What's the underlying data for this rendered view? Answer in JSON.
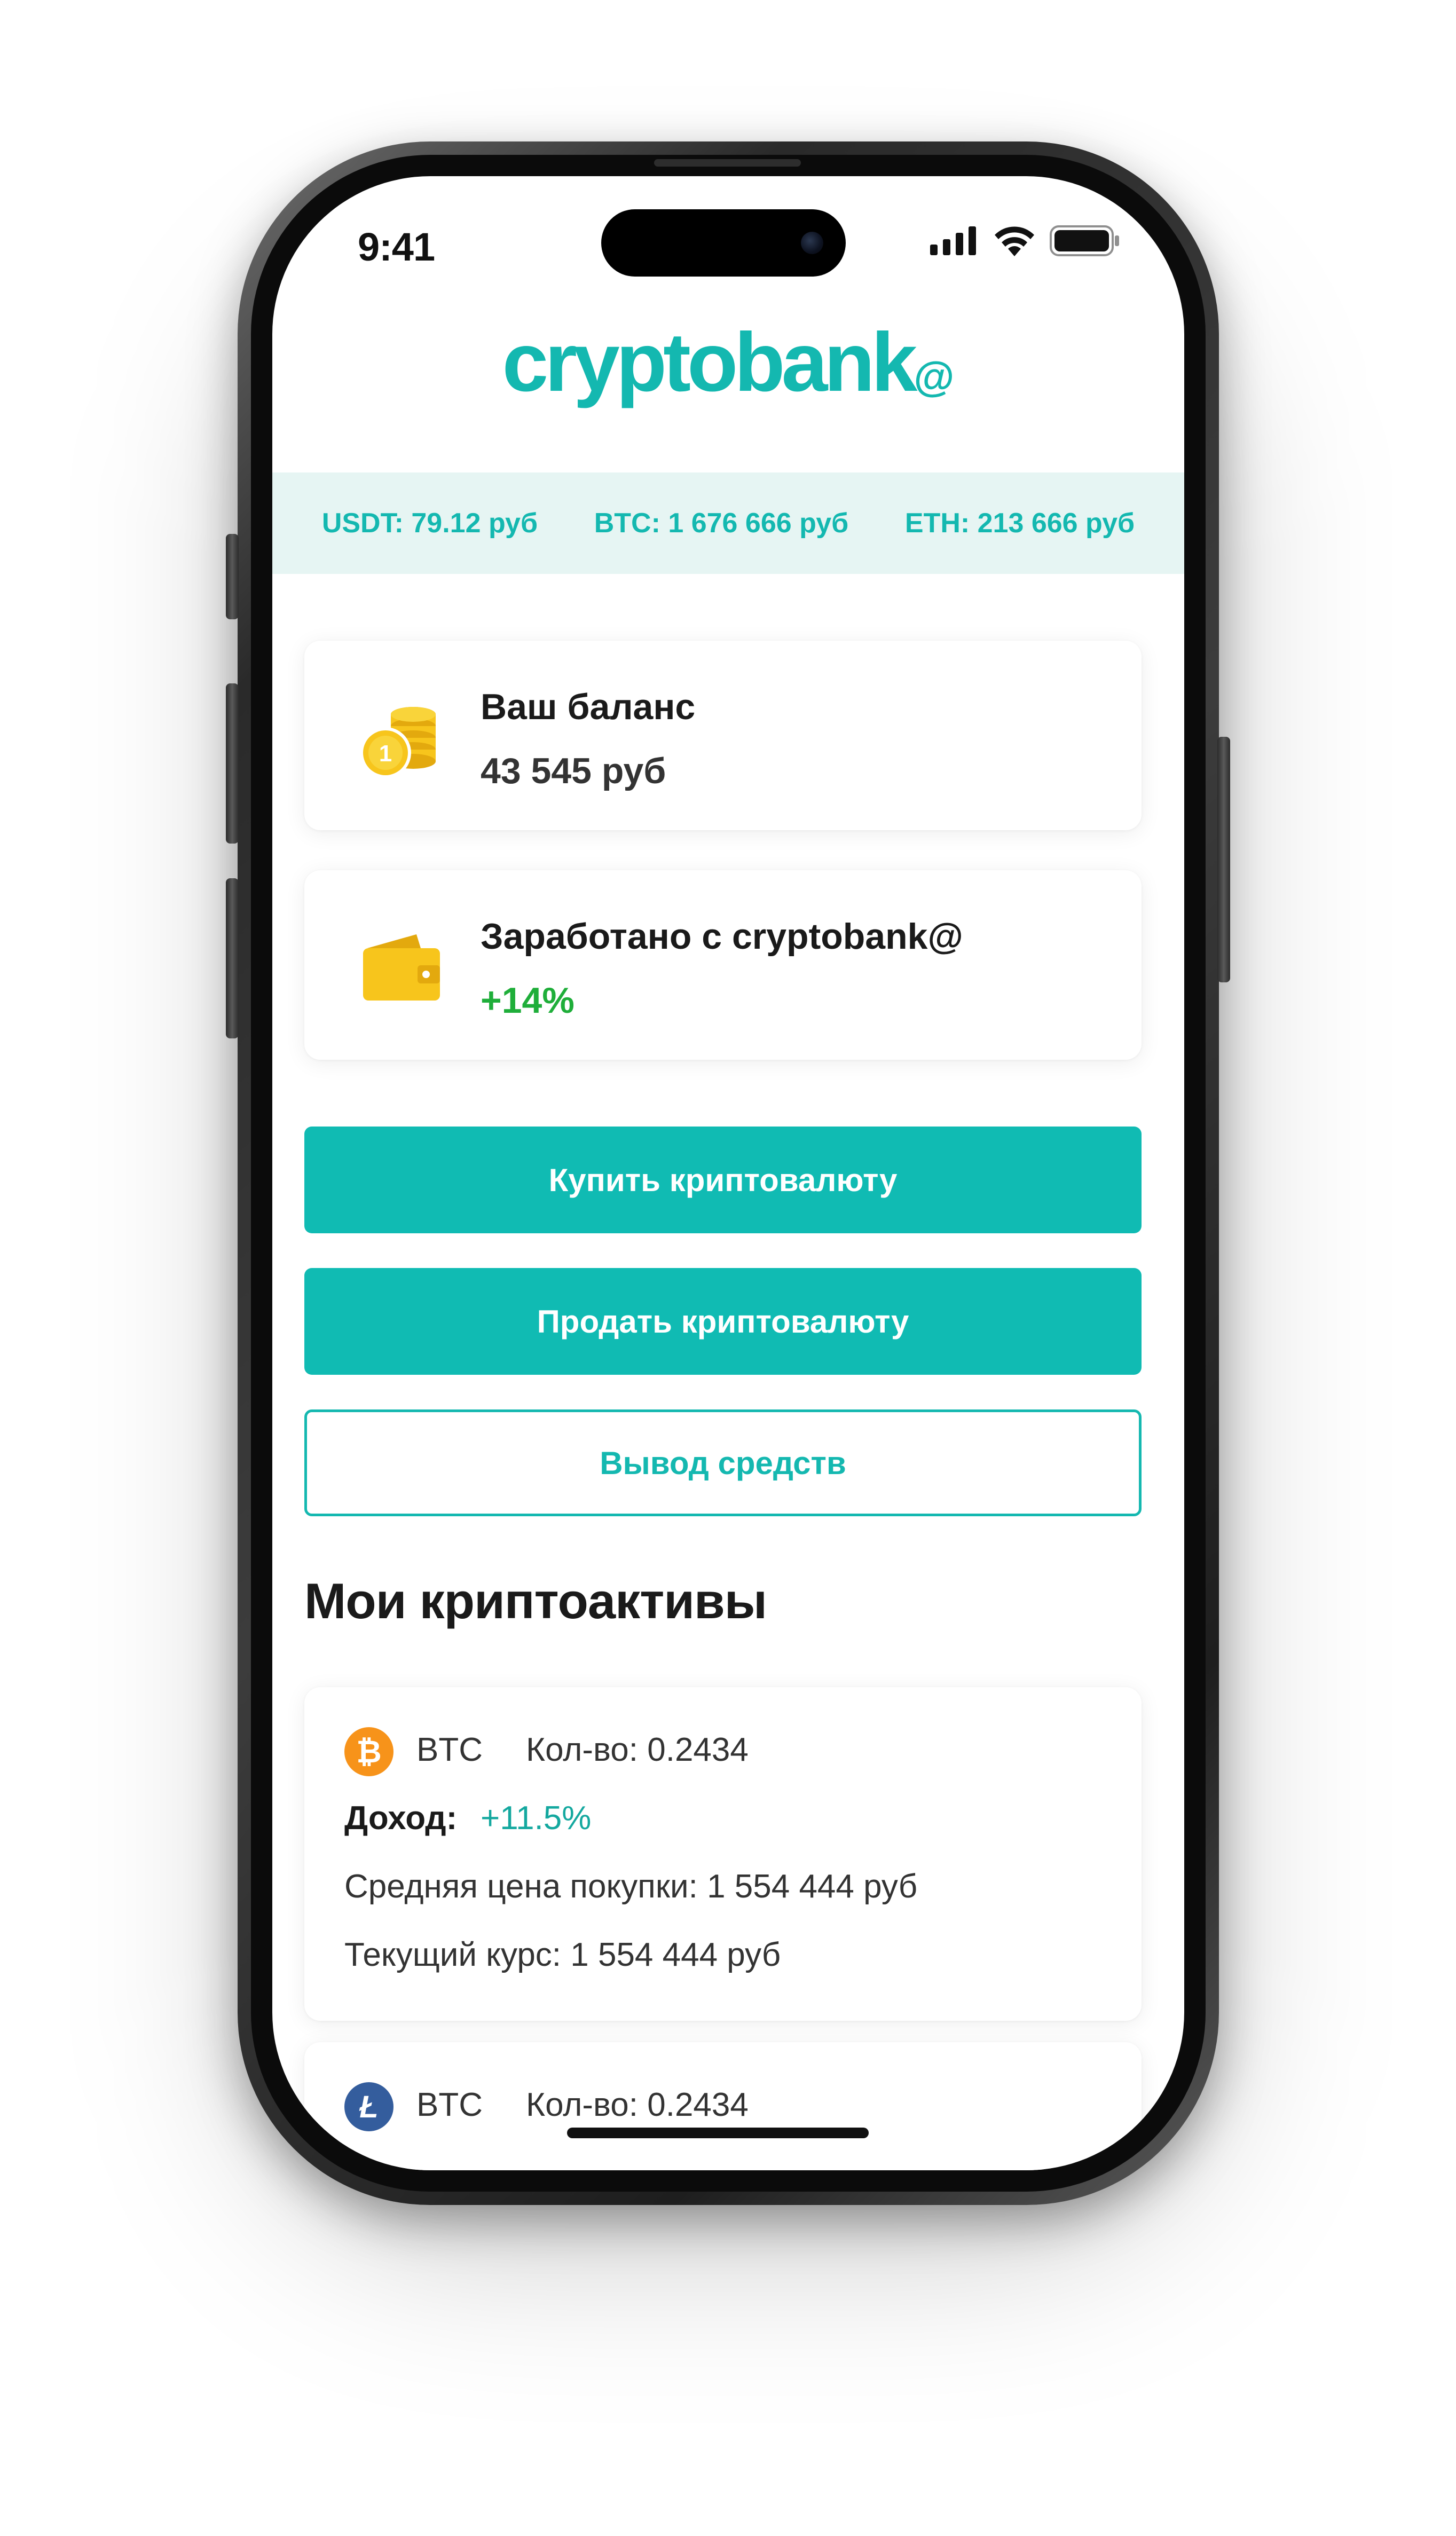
{
  "status_bar": {
    "time": "9:41"
  },
  "header": {
    "logo_text": "cryptobank",
    "logo_suffix": "@"
  },
  "ticker": [
    {
      "label": "USDT: 79.12 руб"
    },
    {
      "label": "BTC: 1 676 666 руб"
    },
    {
      "label": "ETH: 213 666 руб"
    }
  ],
  "balance_card": {
    "label": "Ваш баланс",
    "value": "43 545 руб",
    "icon": "coins-icon"
  },
  "earned_card": {
    "label": "Заработано с cryptobank@",
    "value": "+14%",
    "icon": "wallet-icon"
  },
  "actions": {
    "buy_label": "Купить криптовалюту",
    "sell_label": "Продать криптовалюту",
    "withdraw_label": "Вывод средств"
  },
  "assets_section": {
    "title": "Мои криптоактивы",
    "items": [
      {
        "coin_icon": "bitcoin-icon",
        "ticker": "BTC",
        "amount": "Кол-во: 0.2434",
        "income_label": "Доход:",
        "income_value": "+11.5%",
        "avg_price": "Средняя цена покупки: 1 554 444 руб",
        "current_rate": "Текущий курс: 1 554 444 руб"
      },
      {
        "coin_icon": "litecoin-icon",
        "ticker": "BTC",
        "amount": "Кол-во: 0.2434"
      }
    ]
  },
  "colors": {
    "accent": "#10bbb3",
    "accent_text": "#14b8b0",
    "ticker_bg": "#e6f5f3",
    "positive": "#1fae3a",
    "coin_gold": "#f7c51c",
    "bitcoin_orange": "#f7931a",
    "litecoin_blue": "#345d9d"
  }
}
